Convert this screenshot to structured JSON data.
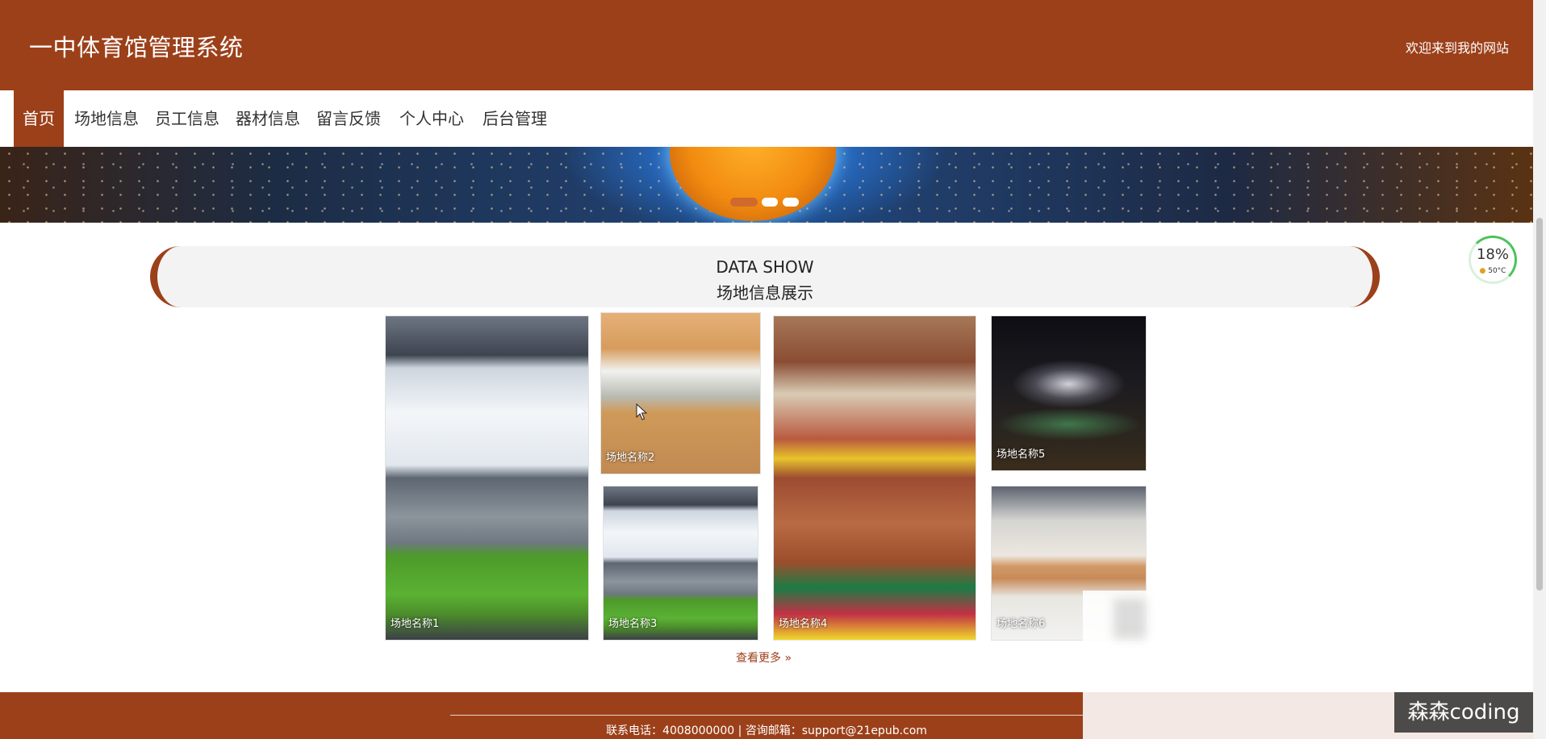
{
  "header": {
    "title": "一中体育馆管理系统",
    "welcome": "欢迎来到我的网站"
  },
  "nav": {
    "items": [
      {
        "label": "首页",
        "active": true
      },
      {
        "label": "场地信息"
      },
      {
        "label": "员工信息"
      },
      {
        "label": "器材信息"
      },
      {
        "label": "留言反馈"
      },
      {
        "label": "个人中心"
      },
      {
        "label": "后台管理"
      }
    ]
  },
  "banner": {
    "slide_count": 3,
    "active_slide": 1
  },
  "section": {
    "title_en": "DATA SHOW",
    "title_cn": "场地信息展示"
  },
  "gallery": {
    "items": [
      {
        "label": "场地名称1",
        "image": "stadium-image"
      },
      {
        "label": "场地名称2",
        "image": "gym-image"
      },
      {
        "label": "场地名称3",
        "image": "stadium-image"
      },
      {
        "label": "场地名称4",
        "image": "arena-image"
      },
      {
        "label": "场地名称5",
        "image": "night-stadium-image"
      },
      {
        "label": "场地名称6",
        "image": "hall-image"
      }
    ],
    "more_label": "查看更多",
    "more_icon": "double-chevron-right-icon"
  },
  "footer": {
    "contact": "联系电话：4008000000 | 咨询邮箱：support@21epub.com"
  },
  "monitor": {
    "percent": "18%",
    "temp": "50°C"
  },
  "watermark": {
    "text": "森森coding"
  },
  "colors": {
    "brand": "#9c401a",
    "footer": "#9c401a",
    "nav_text": "#333333"
  }
}
